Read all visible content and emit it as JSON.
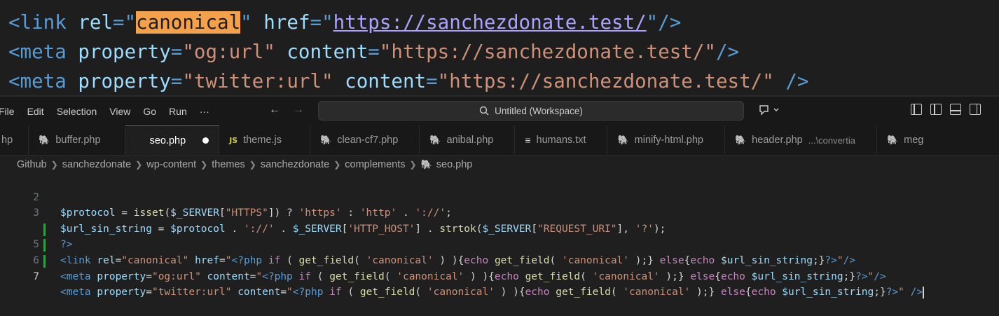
{
  "preview": {
    "line1": {
      "open": "<link ",
      "attr1": "rel",
      "eq1": "=\"",
      "hl": "canonical",
      "close1": "\" ",
      "attr2": "href",
      "eq2": "=\"",
      "url": "https://sanchezdonate.test/",
      "end": "\"/>"
    },
    "line2": {
      "open": "<meta ",
      "attr1": "property",
      "eq1": "=",
      "val1": "\"og:url\"",
      "sp": " ",
      "attr2": "content",
      "eq2": "=",
      "val2": "\"https://sanchezdonate.test/\"",
      "end": "/>"
    },
    "line3": {
      "open": "<meta ",
      "attr1": "property",
      "eq1": "=",
      "val1": "\"twitter:url\"",
      "sp": " ",
      "attr2": "content",
      "eq2": "=",
      "val2": "\"https://sanchezdonate.test/\"",
      "end": " />"
    }
  },
  "menu": [
    "File",
    "Edit",
    "Selection",
    "View",
    "Go",
    "Run",
    "···"
  ],
  "nav": {
    "back": "←",
    "forward": "→"
  },
  "search": {
    "icon": "search-icon",
    "text": "Untitled (Workspace)"
  },
  "copilot": {
    "icon": "copilot-icon",
    "label": "⌥⌄"
  },
  "tabs": [
    {
      "label": "hp",
      "icon": "",
      "active": false
    },
    {
      "label": "buffer.php",
      "icon": "php",
      "active": false
    },
    {
      "label": "seo.php",
      "icon": "",
      "active": true,
      "modified": true
    },
    {
      "label": "theme.js",
      "icon": "js",
      "active": false
    },
    {
      "label": "clean-cf7.php",
      "icon": "php",
      "active": false
    },
    {
      "label": "anibal.php",
      "icon": "php",
      "active": false
    },
    {
      "label": "humans.txt",
      "icon": "txt",
      "active": false
    },
    {
      "label": "minify-html.php",
      "icon": "php",
      "active": false
    },
    {
      "label": "header.php",
      "icon": "php",
      "active": false,
      "desc": "...\\convertia"
    },
    {
      "label": "meg",
      "icon": "php",
      "active": false
    }
  ],
  "breadcrumb": [
    "Github",
    "sanchezdonate",
    "wp-content",
    "themes",
    "sanchezdonate",
    "complements",
    "seo.php"
  ],
  "editor": {
    "lines": [
      {
        "n": "2",
        "mod": false
      },
      {
        "n": "3",
        "mod": false
      },
      {
        "n": "",
        "mod": false
      },
      {
        "n": "5",
        "mod": true
      },
      {
        "n": "6",
        "mod": true
      },
      {
        "n": "7",
        "mod": true
      }
    ],
    "colors": {
      "accent": "#0078d4",
      "added": "#2ea043",
      "highlight": "#f5a04a"
    }
  }
}
